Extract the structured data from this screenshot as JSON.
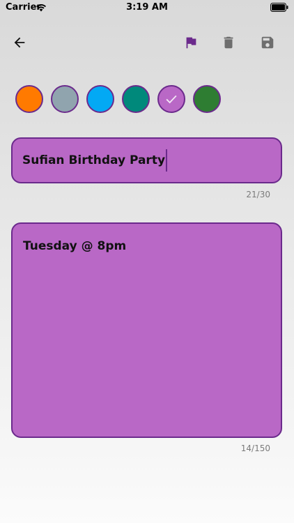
{
  "status_bar": {
    "carrier": "Carrier",
    "time": "3:19 AM"
  },
  "toolbar": {
    "back_icon": "arrow-left-icon",
    "flag_icon": "flag-icon",
    "delete_icon": "trash-icon",
    "save_icon": "save-icon",
    "accent_color": "#6b2a8c",
    "muted_color": "#6e6e6e"
  },
  "colors": {
    "options": [
      "#ff7a00",
      "#90a4ae",
      "#03a9f4",
      "#00897b",
      "#b968c6",
      "#2e7d32"
    ],
    "selected_index": 4
  },
  "title_field": {
    "value": "Sufian Birthday Party",
    "counter": "21/30"
  },
  "body_field": {
    "value": "Tuesday @ 8pm",
    "counter": "14/150"
  }
}
